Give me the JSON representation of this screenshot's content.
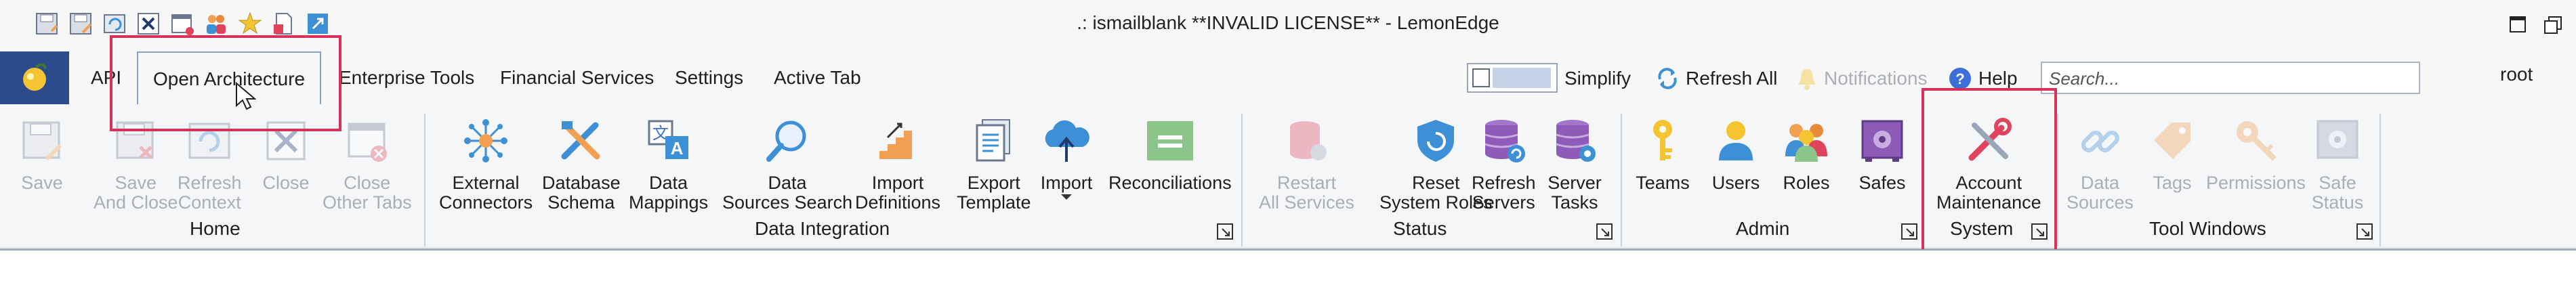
{
  "window": {
    "title": ".: ismailblank **INVALID LICENSE** - LemonEdge"
  },
  "quick_access": {
    "icons": [
      "save-icon",
      "save-as-icon",
      "refresh-icon",
      "close-icon",
      "window-icon",
      "users-icon",
      "favourites-icon",
      "new-document-icon",
      "expand-icon"
    ]
  },
  "tabs": [
    {
      "label": "API",
      "active": false
    },
    {
      "label": "Open Architecture",
      "active": true
    },
    {
      "label": "Enterprise Tools",
      "active": false
    },
    {
      "label": "Financial Services",
      "active": false
    },
    {
      "label": "Settings",
      "active": false
    },
    {
      "label": "Active Tab",
      "active": false
    }
  ],
  "header": {
    "simplify_label": "Simplify",
    "refresh_all_label": "Refresh All",
    "notifications_label": "Notifications",
    "help_label": "Help",
    "search_placeholder": "Search...",
    "user": "root"
  },
  "ribbon": {
    "groups": [
      {
        "name": "Home",
        "buttons": [
          {
            "label": "Save",
            "enabled": false
          },
          {
            "label": "Save\nAnd Close",
            "enabled": false
          },
          {
            "label": "Refresh\nContext",
            "enabled": false
          },
          {
            "label": "Close",
            "enabled": false
          },
          {
            "label": "Close\nOther Tabs",
            "enabled": false
          }
        ]
      },
      {
        "name": "Data Integration",
        "buttons": [
          {
            "label": "External\nConnectors",
            "enabled": true
          },
          {
            "label": "Database\nSchema",
            "enabled": true
          },
          {
            "label": "Data\nMappings",
            "enabled": true
          },
          {
            "label": "Data\nSources Search",
            "enabled": true
          },
          {
            "label": "Import\nDefinitions",
            "enabled": true
          },
          {
            "label": "Export\nTemplate",
            "enabled": true
          },
          {
            "label": "Import",
            "enabled": true
          },
          {
            "label": "Reconciliations",
            "enabled": true
          }
        ]
      },
      {
        "name": "Status",
        "buttons": [
          {
            "label": "Restart\nAll Services",
            "enabled": false
          },
          {
            "label": "Reset\nSystem Roles",
            "enabled": true
          },
          {
            "label": "Refresh\nServers",
            "enabled": true
          },
          {
            "label": "Server\nTasks",
            "enabled": true
          }
        ]
      },
      {
        "name": "Admin",
        "buttons": [
          {
            "label": "Teams",
            "enabled": true
          },
          {
            "label": "Users",
            "enabled": true
          },
          {
            "label": "Roles",
            "enabled": true
          },
          {
            "label": "Safes",
            "enabled": true
          }
        ]
      },
      {
        "name": "System",
        "buttons": [
          {
            "label": "Account\nMaintenance",
            "enabled": true
          }
        ]
      },
      {
        "name": "Tool Windows",
        "buttons": [
          {
            "label": "Data\nSources",
            "enabled": false
          },
          {
            "label": "Tags",
            "enabled": false
          },
          {
            "label": "Permissions",
            "enabled": false
          },
          {
            "label": "Safe\nStatus",
            "enabled": false
          }
        ]
      }
    ]
  },
  "colors": {
    "accent": "#2b4b8d",
    "icon_blue": "#3d8fd6",
    "icon_orange": "#f0a050",
    "highlight": "#d9325a",
    "disabled_text": "#a9aeb7"
  }
}
